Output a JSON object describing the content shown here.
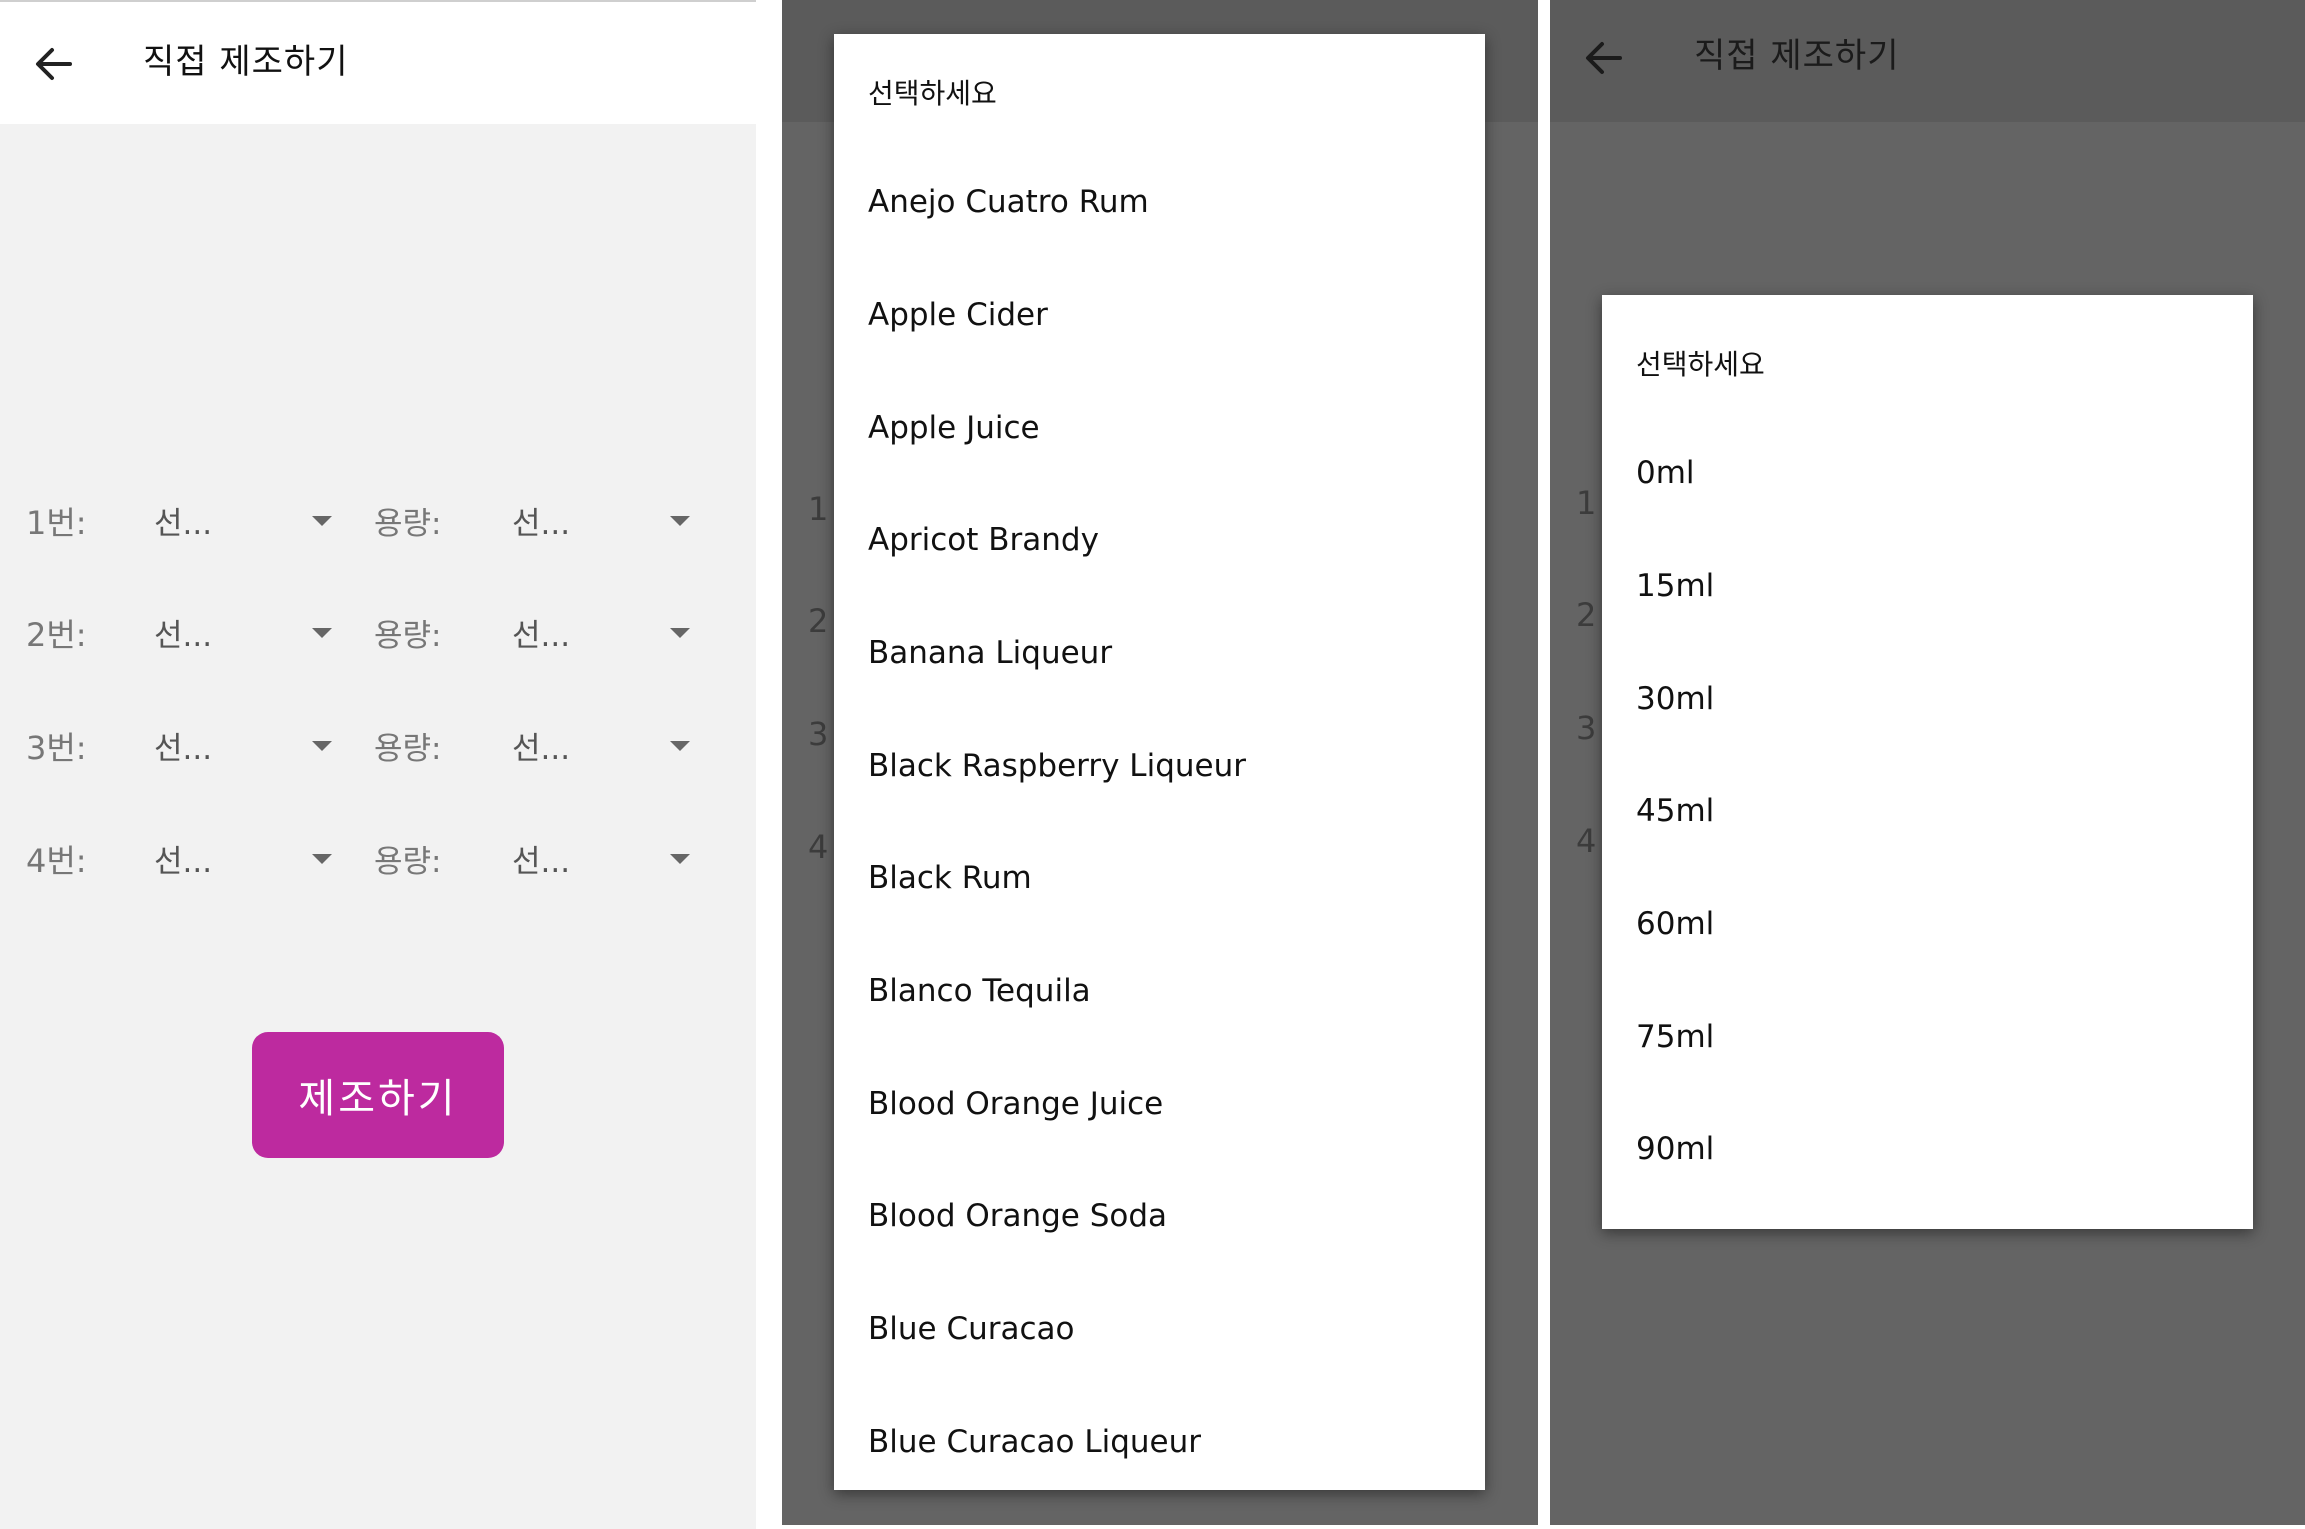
{
  "screens": {
    "main": {
      "title": "직접 제조하기",
      "rows": [
        {
          "label": "1번:",
          "ingredient": "선...",
          "volume_label": "용량:",
          "volume": "선..."
        },
        {
          "label": "2번:",
          "ingredient": "선...",
          "volume_label": "용량:",
          "volume": "선..."
        },
        {
          "label": "3번:",
          "ingredient": "선...",
          "volume_label": "용량:",
          "volume": "선..."
        },
        {
          "label": "4번:",
          "ingredient": "선...",
          "volume_label": "용량:",
          "volume": "선..."
        }
      ],
      "make_button": "제조하기"
    },
    "ingredient_dropdown": {
      "options": [
        "선택하세요",
        "Anejo Cuatro Rum",
        "Apple Cider",
        "Apple Juice",
        "Apricot Brandy",
        "Banana Liqueur",
        "Black Raspberry Liqueur",
        "Black Rum",
        "Blanco Tequila",
        "Blood Orange Juice",
        "Blood Orange Soda",
        "Blue Curacao",
        "Blue Curacao Liqueur"
      ],
      "behind_labels": [
        "1",
        "2",
        "3",
        "4"
      ]
    },
    "volume_dropdown": {
      "title": "직접 제조하기",
      "options": [
        "선택하세요",
        "0ml",
        "15ml",
        "30ml",
        "45ml",
        "60ml",
        "75ml",
        "90ml"
      ],
      "behind_labels": [
        "1",
        "2",
        "3",
        "4"
      ]
    }
  },
  "colors": {
    "accent": "#bd2a9f",
    "background": "#f2f2f2",
    "scrim": "#646464"
  },
  "icons": {
    "back": "arrow-left-icon",
    "dropdown": "triangle-down-icon"
  }
}
